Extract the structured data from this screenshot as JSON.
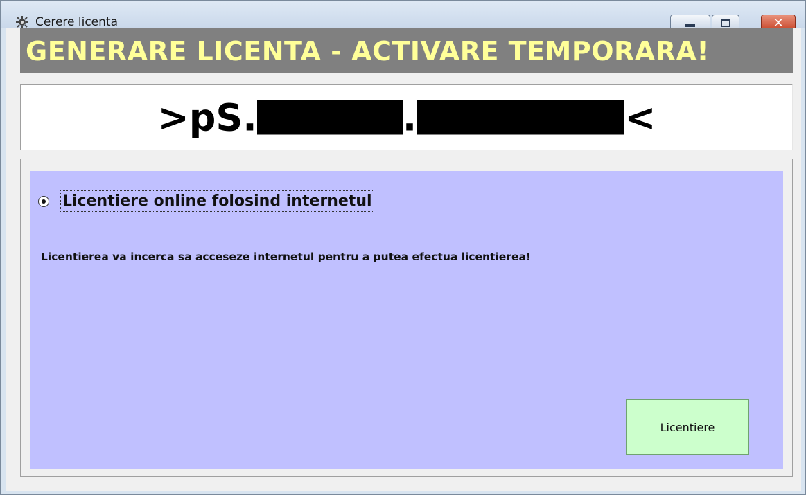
{
  "window": {
    "title": "Cerere licenta",
    "app_icon": "gear-spider-icon",
    "controls": {
      "minimize_icon": "minimize-icon",
      "maximize_icon": "maximize-icon",
      "close_label": "✕"
    }
  },
  "header": {
    "title": "GENERARE LICENTA - ACTIVARE TEMPORARA!",
    "background_color": "#808080",
    "text_color": "#ffff99"
  },
  "license_code": {
    "prefix": ">pS.",
    "separator": ".",
    "suffix": "<"
  },
  "online_option": {
    "label": "Licentiere online folosind internetul",
    "selected": true,
    "description": "Licentierea va incerca sa acceseze internetul pentru a putea efectua licentierea!",
    "panel_color": "#c0c0ff"
  },
  "actions": {
    "license_button_label": "Licentiere",
    "license_button_color": "#ccffcc"
  }
}
